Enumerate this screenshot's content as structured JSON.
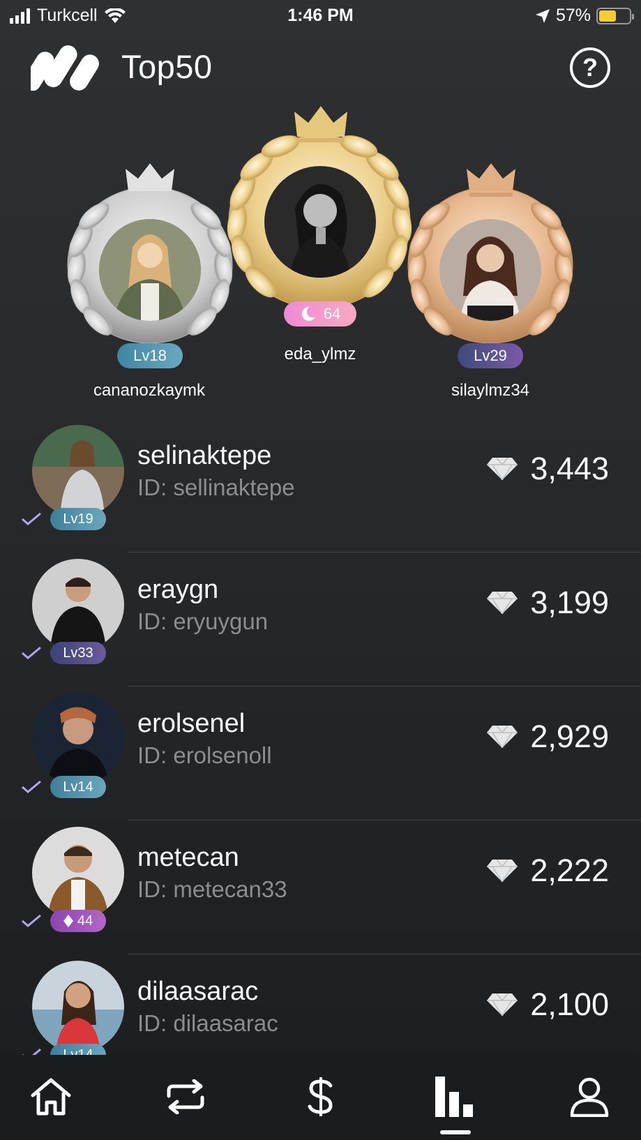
{
  "status_bar": {
    "carrier": "Turkcell",
    "time": "1:46 PM",
    "battery_percent": "57%",
    "battery_level": 0.57,
    "battery_color": "#f6cf2f"
  },
  "header": {
    "title": "Top50",
    "help_label": "?"
  },
  "podium": {
    "first": {
      "username": "eda_ylmz",
      "badge_value": "64",
      "badge_icon": "moon-icon",
      "rank_color": "gold"
    },
    "second": {
      "username": "cananozkaymk",
      "level": "Lv18",
      "rank_color": "silver"
    },
    "third": {
      "username": "silaylmz34",
      "level": "Lv29",
      "rank_color": "bronze"
    }
  },
  "leaderboard": [
    {
      "name": "selinaktepe",
      "id": "ID: sellinaktepe",
      "badge": "Lv19",
      "score": "3,443",
      "badge_color": "#4c8fa6"
    },
    {
      "name": "eraygn",
      "id": "ID: eryuygun",
      "badge": "Lv33",
      "score": "3,199",
      "badge_color": "#4a4f86"
    },
    {
      "name": "erolsenel",
      "id": "ID: erolsenoll",
      "badge": "Lv14",
      "score": "2,929",
      "badge_color": "#4c8fa6"
    },
    {
      "name": "metecan",
      "id": "ID: metecan33",
      "badge": "44",
      "score": "2,222",
      "badge_color": "#9b4fb8",
      "badge_icon": "diamond-icon"
    },
    {
      "name": "dilaasarac",
      "id": "ID: dilaasarac",
      "badge": "Lv14",
      "score": "2,100",
      "badge_color": "#4c8fa6"
    }
  ],
  "tab_bar": {
    "tabs": [
      "home-icon",
      "repeat-icon",
      "dollar-icon",
      "leaderboard-icon",
      "profile-icon"
    ],
    "active": "leaderboard-icon"
  }
}
